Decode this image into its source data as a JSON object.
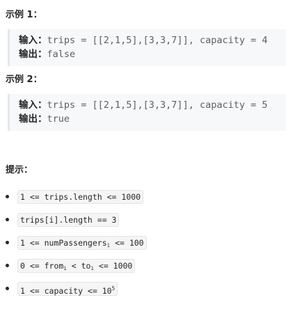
{
  "example1": {
    "heading": "示例 1：",
    "input_label": "输入：",
    "input_value": "trips = [[2,1,5],[3,3,7]], capacity = 4",
    "output_label": "输出：",
    "output_value": "false"
  },
  "example2": {
    "heading": "示例 2：",
    "input_label": "输入：",
    "input_value": "trips = [[2,1,5],[3,3,7]], capacity = 5",
    "output_label": "输出：",
    "output_value": "true"
  },
  "hints": {
    "heading": "提示：",
    "items": [
      {
        "text": "1 <= trips.length <= 1000"
      },
      {
        "text": "trips[i].length == 3"
      },
      {
        "pre": "1 <= numPassengers",
        "sub": "i",
        "post": " <= 100"
      },
      {
        "pre": "0 <= from",
        "sub1": "i",
        "mid": " < to",
        "sub2": "i",
        "post": " <= 1000"
      },
      {
        "pre": "1 <= capacity <= 10",
        "sup": "5"
      }
    ]
  }
}
